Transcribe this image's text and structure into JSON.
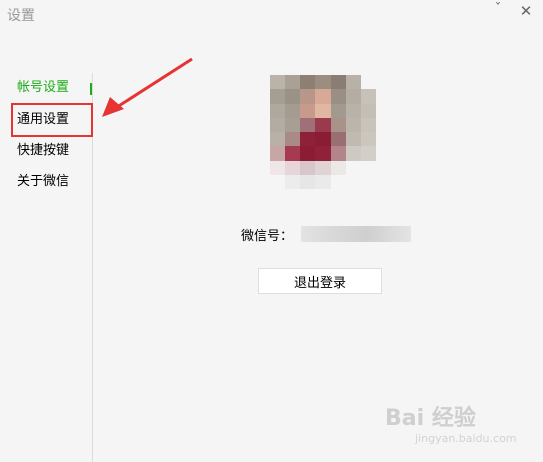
{
  "window": {
    "title": "设置",
    "minimize_glyph": "ˇ",
    "close_glyph": "✕"
  },
  "sidebar": {
    "items": [
      {
        "label": "帐号设置",
        "active": true
      },
      {
        "label": "通用设置",
        "active": false
      },
      {
        "label": "快捷按键",
        "active": false
      },
      {
        "label": "关于微信",
        "active": false
      }
    ]
  },
  "account": {
    "avatar_icon": "avatar-pixelated",
    "wechat_id_label": "微信号："
  },
  "logout_label": "退出登录",
  "watermark": {
    "text": "Bai 经验",
    "sub": "jingyan.baidu.com"
  },
  "colors": {
    "accent": "#1aad19",
    "annotation": "#e63333",
    "background": "#f5f5f5"
  }
}
